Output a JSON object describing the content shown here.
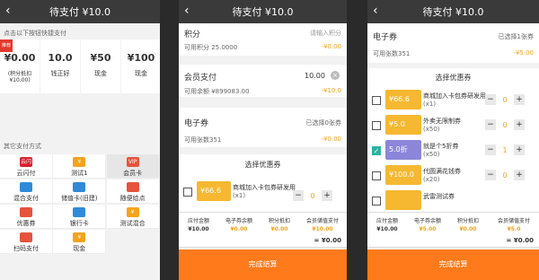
{
  "panel1": {
    "title": "待支付 ¥10.0",
    "quick_hint": "点击以下按钮快捷支付",
    "quick": [
      {
        "amount": "¥0.00",
        "sub": "(积分抵扣¥10.00)",
        "label": "",
        "badge": "推荐"
      },
      {
        "amount": "10.0",
        "sub": "",
        "label": "钱正好",
        "badge": ""
      },
      {
        "amount": "¥50",
        "sub": "",
        "label": "现金",
        "badge": ""
      },
      {
        "amount": "¥100",
        "sub": "",
        "label": "现金",
        "badge": ""
      }
    ],
    "other_title": "其它支付方式",
    "methods": [
      {
        "label": "云闪付",
        "icon": "unionpay-icon",
        "icon_text": "云闪付",
        "color": "#d8202d"
      },
      {
        "label": "测试1",
        "icon": "yen-icon",
        "icon_text": "¥",
        "color": "#f5a31c"
      },
      {
        "label": "会员卡",
        "icon": "vip-icon",
        "icon_text": "VIP",
        "color": "#e5533d"
      },
      {
        "label": "混合支付",
        "icon": "mixed-pay-icon",
        "icon_text": "",
        "color": "#2f8bd9"
      },
      {
        "label": "储值卡(旧建)",
        "icon": "stored-card-icon",
        "icon_text": "",
        "color": "#2f8bd9"
      },
      {
        "label": "随便给点",
        "icon": "gift-icon",
        "icon_text": "",
        "color": "#e5533d"
      },
      {
        "label": "优惠券",
        "icon": "coupon-icon",
        "icon_text": "",
        "color": "#e5533d"
      },
      {
        "label": "银行卡",
        "icon": "bank-card-icon",
        "icon_text": "",
        "color": "#2f8bd9"
      },
      {
        "label": "测试混合",
        "icon": "yen-icon",
        "icon_text": "¥",
        "color": "#f5a31c"
      },
      {
        "label": "扫码支付",
        "icon": "scan-icon",
        "icon_text": "",
        "color": "#e5533d"
      },
      {
        "label": "现金",
        "icon": "cash-icon",
        "icon_text": "¥",
        "color": "#f5a31c"
      }
    ]
  },
  "panel2": {
    "title": "待支付 ¥10.0",
    "points_label": "积分",
    "points_placeholder": "请输入积分",
    "points_available": "可用积分 25.0000",
    "points_value": "-¥0.00",
    "member_label": "会员支付",
    "member_amount": "10.00",
    "member_balance": "可用余额 ¥899083.00",
    "member_value": "-¥10.0",
    "ecoupon_label": "电子券",
    "ecoupon_selected": "已选择0张券",
    "ecoupon_count": "可用张数351",
    "ecoupon_value": "-¥0.00",
    "select_coupon_title": "选择优惠券",
    "coupon": {
      "img_text": "¥66.6",
      "name": "商城加入卡包券研发用",
      "qty": "(x1)",
      "count": "0"
    },
    "summary": {
      "cols": [
        {
          "label": "应付金额",
          "value": "¥10.00"
        },
        {
          "label": "电子券余额",
          "value": "¥0.00"
        },
        {
          "label": "积分抵扣",
          "value": "¥0.00"
        },
        {
          "label": "会员储值支付",
          "value": "¥10.00"
        }
      ],
      "total": "= ¥0.00"
    },
    "button": "完成结算"
  },
  "panel3": {
    "title": "待支付 ¥10.0",
    "ecoupon_label": "电子券",
    "ecoupon_selected": "已选择1张券",
    "ecoupon_count": "可用张数351",
    "ecoupon_value": "-¥5.00",
    "select_coupon_title": "选择优惠券",
    "coupons": [
      {
        "img_text": "¥66.6",
        "name": "商城加入卡包券研发用",
        "qty": "(x1)",
        "count": "0",
        "checked": false,
        "color": "#f5b830"
      },
      {
        "img_text": "¥5.0",
        "name": "外卖无限制券",
        "qty": "(x50)",
        "count": "0",
        "checked": false,
        "color": "#f5b830"
      },
      {
        "img_text": "5.0折",
        "name": "就是个5折券",
        "qty": "(x50)",
        "count": "1",
        "checked": true,
        "color": "#8b86d9"
      },
      {
        "img_text": "¥100.0",
        "name": "代圆满花钱券",
        "qty": "(x20)",
        "count": "0",
        "checked": false,
        "color": "#f5b830"
      },
      {
        "img_text": "",
        "name": "武雷测试券",
        "qty": "",
        "count": "",
        "checked": false,
        "color": "#f5b830"
      }
    ],
    "summary": {
      "cols": [
        {
          "label": "应付金额",
          "value": "¥10.00"
        },
        {
          "label": "电子券余额",
          "value": "¥5.00"
        },
        {
          "label": "积分抵扣",
          "value": "¥0.00"
        },
        {
          "label": "会员储值支付",
          "value": "¥5.0"
        }
      ],
      "total": "= ¥0.00"
    },
    "button": "完成结算"
  }
}
